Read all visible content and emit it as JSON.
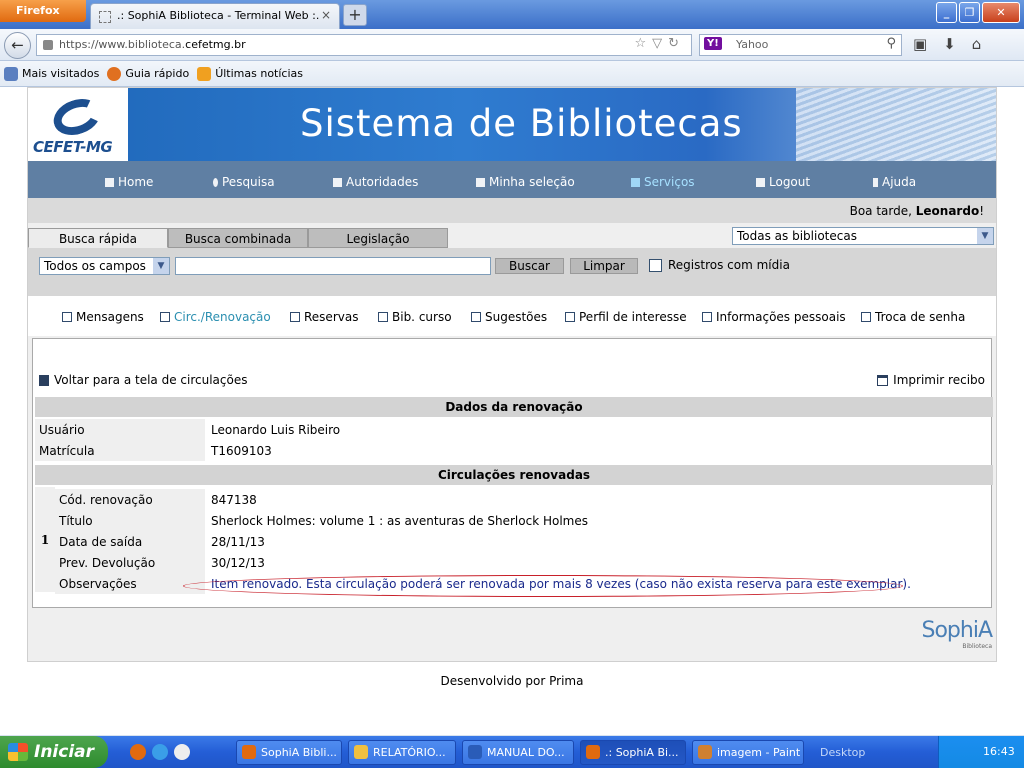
{
  "browser": {
    "menu_label": "Firefox",
    "tab_title": ".: SophiA Biblioteca - Terminal Web :.",
    "url_prefix": "https://www.biblioteca.",
    "url_domain": "cefetmg.br",
    "search_engine": "Yahoo",
    "bookmarks": [
      "Mais visitados",
      "Guia rápido",
      "Últimas notícias"
    ]
  },
  "site": {
    "logo_text": "CEFET-MG",
    "banner_title": "Sistema de Bibliotecas",
    "menu": [
      "Home",
      "Pesquisa",
      "Autoridades",
      "Minha seleção",
      "Serviços",
      "Logout",
      "Ajuda"
    ],
    "greeting": "Boa tarde,",
    "user_first_name": "Leonardo",
    "greeting_end": "!"
  },
  "search": {
    "tabs": [
      "Busca rápida",
      "Busca combinada",
      "Legislação"
    ],
    "library_select": "Todas as bibliotecas",
    "field_select": "Todos os campos",
    "query_value": "",
    "search_button": "Buscar",
    "clear_button": "Limpar",
    "media_checkbox_label": "Registros com mídia"
  },
  "services_menu": [
    "Mensagens",
    "Circ./Renovação",
    "Reservas",
    "Bib. curso",
    "Sugestões",
    "Perfil de interesse",
    "Informações pessoais",
    "Troca de senha"
  ],
  "renewal": {
    "back_link": "Voltar para a tela de circulações",
    "print_link": "Imprimir recibo",
    "section_title": "Dados da renovação",
    "user_label": "Usuário",
    "user_value": "Leonardo Luis Ribeiro",
    "registration_label": "Matrícula",
    "registration_value": "T1609103",
    "circ_section_title": "Circulações renovadas",
    "row_number": "1",
    "fields": [
      {
        "label": "Cód. renovação",
        "value": "847138"
      },
      {
        "label": "Título",
        "value": "Sherlock Holmes: volume 1 : as aventuras de Sherlock Holmes"
      },
      {
        "label": "Data de saída",
        "value": "28/11/13"
      },
      {
        "label": "Prev. Devolução",
        "value": "30/12/13"
      },
      {
        "label": "Observações",
        "value": "Item renovado. Esta circulação poderá ser renovada por mais 8 vezes (caso não exista reserva para este exemplar)."
      }
    ]
  },
  "brand": {
    "name": "SophiA",
    "sub": "Biblioteca"
  },
  "footer": "Desenvolvido por Prima",
  "taskbar": {
    "start_label": "Iniciar",
    "windows": [
      "SophiA Bibli...",
      "RELATÓRIO...",
      "MANUAL DO...",
      ".: SophiA Bi...",
      "imagem - Paint"
    ],
    "desktop_label": "Desktop",
    "clock": "16:43"
  }
}
